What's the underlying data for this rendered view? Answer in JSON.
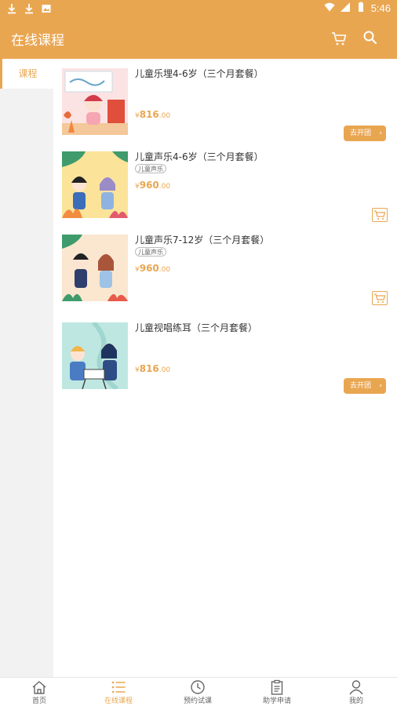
{
  "status_bar": {
    "time": "5:46"
  },
  "app_bar": {
    "title": "在线课程"
  },
  "sidebar": {
    "categories": [
      {
        "label": "课程"
      }
    ]
  },
  "courses": [
    {
      "title": "儿童乐埋4-6岁（三个月套餐）",
      "tag": "",
      "currency": "¥",
      "price": "816",
      "decimal": ".00",
      "action_label": "去开团"
    },
    {
      "title": "儿童声乐4-6岁（三个月套餐）",
      "tag": "儿童声乐",
      "currency": "¥",
      "price": "960",
      "decimal": ".00",
      "action_label": ""
    },
    {
      "title": "儿童声乐7-12岁（三个月套餐）",
      "tag": "儿童声乐",
      "currency": "¥",
      "price": "960",
      "decimal": ".00",
      "action_label": ""
    },
    {
      "title": "儿童视唱练耳（三个月套餐）",
      "tag": "",
      "currency": "¥",
      "price": "816",
      "decimal": ".00",
      "action_label": "去开团"
    }
  ],
  "tabbar": {
    "tabs": [
      {
        "label": "首页",
        "icon": "home-icon"
      },
      {
        "label": "在线课程",
        "icon": "list-icon"
      },
      {
        "label": "预约试课",
        "icon": "clock-icon"
      },
      {
        "label": "助学申请",
        "icon": "clipboard-icon"
      },
      {
        "label": "我的",
        "icon": "user-icon"
      }
    ],
    "active_index": 1
  },
  "colors": {
    "accent": "#e9a651",
    "sidebar_bg": "#f2f2f2"
  }
}
